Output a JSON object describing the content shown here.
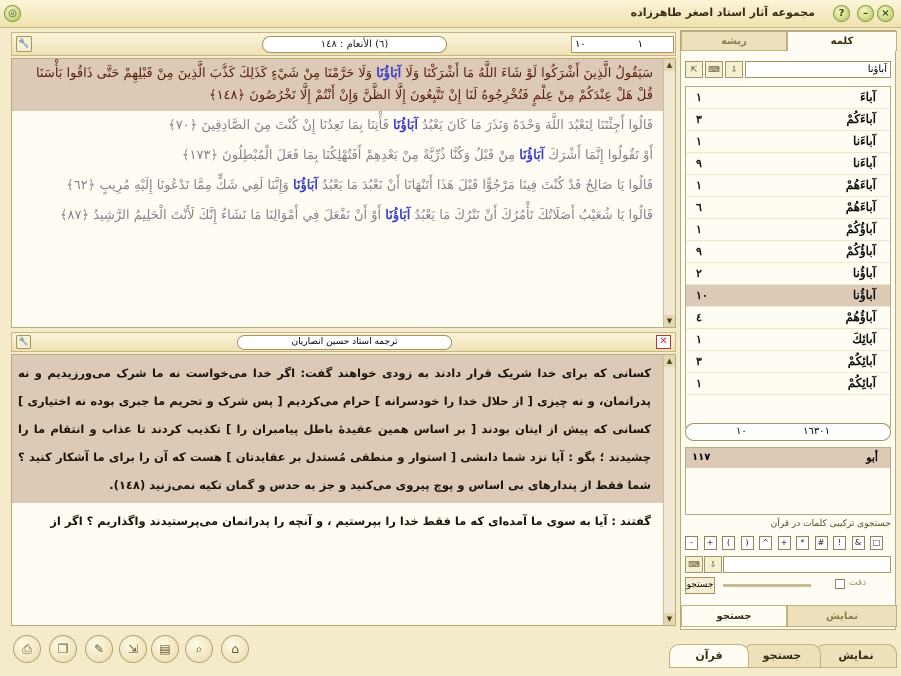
{
  "app": {
    "title": "مجموعه آثار استاد اصغر طاهرزاده"
  },
  "verse_bar": {
    "surah": "(٦) الأنعام : ١٤٨",
    "ayah_left": "١٠",
    "ayah_right": "١"
  },
  "verses": [
    {
      "before": "سَيَقُولُ الَّذِينَ أَشْرَكُوا لَوْ شَاءَ اللَّهُ مَا أَشْرَكْنَا وَلَا ",
      "hl": "آبَاؤُنَا",
      "after": " وَلَا حَرَّمْنَا مِنْ شَيْءٍ كَذَلِكَ كَذَّبَ الَّذِينَ مِنْ قَبْلِهِمْ حَتَّى ذَاقُوا بَأْسَنَا قُلْ هَلْ عِنْدَكُمْ مِنْ عِلْمٍ فَتُخْرِجُوهُ لَنَا إِنْ تَتَّبِعُونَ إِلَّا الظَّنَّ وَإِنْ أَنْتُمْ إِلَّا تَخْرُصُونَ ﴿١٤٨﴾"
    },
    {
      "before": "قَالُوا أَجِئْتَنَا لِنَعْبُدَ اللَّهَ وَحْدَهُ وَنَذَرَ مَا كَانَ يَعْبُدُ ",
      "hl": "آبَاؤُنَا",
      "after": " فَأْتِنَا بِمَا تَعِدُنَا إِنْ كُنْتَ مِنَ الصَّادِقِينَ ﴿٧٠﴾"
    },
    {
      "before": "أَوْ تَقُولُوا إِنَّمَا أَشْرَكَ ",
      "hl": "آبَاؤُنَا",
      "after": " مِنْ قَبْلُ وَكُنَّا ذُرِّيَّةً مِنْ بَعْدِهِمْ أَفَتُهْلِكُنَا بِمَا فَعَلَ الْمُبْطِلُونَ ﴿١٧٣﴾"
    },
    {
      "before": "قَالُوا يَا صَالِحُ قَدْ كُنْتَ فِينَا مَرْجُوًّا قَبْلَ هَذَا أَتَنْهَانَا أَنْ نَعْبُدَ مَا يَعْبُدُ ",
      "hl": "آبَاؤُنَا",
      "after": " وَإِنَّنَا لَفِي شَكٍّ مِمَّا تَدْعُونَا إِلَيْهِ مُرِيبٍ ﴿٦٢﴾"
    },
    {
      "before": "قَالُوا يَا شُعَيْبُ أَصَلَاتُكَ تَأْمُرُكَ أَنْ نَتْرُكَ مَا يَعْبُدُ ",
      "hl": "آبَاؤُنَا",
      "after": " أَوْ أَنْ نَفْعَلَ فِي أَمْوَالِنَا مَا نَشَاءُ إِنَّكَ لَأَنْتَ الْحَلِيمُ الرَّشِيدُ ﴿٨٧﴾"
    }
  ],
  "translation": {
    "title": "ترجمه استاد حسين انصاريان",
    "paragraphs": [
      "کسانی که برای خدا شریک قرار دادند به زودی خواهند گفت: اگر خدا می‌خواست نه ما شرک می‌ورزیدیم و نه پدرانمان، و نه چیزی [ از حلال خدا را خودسرانه ] حرام می‌کردیم [ پس شرک و تحریم ما جبری بوده نه اختیاری ] کسانی که پیش از اینان بودند [ بر اساس همین عقیدهٔ باطل پیامبران را ] تکذیب کردند تا عذاب و انتقام ما را چشیدند ؛ بگو : آیا نزد شما دانشی [ استوار و منطقی مُستدل بر عقایدتان ] هست که آن را برای ما آشکار کنید ؟ شما فقط از پندارهای بی اساس و پوچ پیروی می‌کنید و جز به حدس و گمان تکیه نمی‌زنید (١٤٨).",
      "گفتند : آیا به سوی ما آمده‌ای که ما فقط خدا را بپرستیم ، و آنچه را پدرانمان می‌پرستیدند واگذاریم ؟ اگر از"
    ]
  },
  "sidebar": {
    "tab_root": "ریشه",
    "tab_word": "کلمه",
    "word_input": "آباؤنا",
    "words": [
      {
        "w": "آباءَ",
        "c": "١"
      },
      {
        "w": "آباءَكُمْ",
        "c": "٣"
      },
      {
        "w": "آباءَنا",
        "c": "١"
      },
      {
        "w": "آباءَنا",
        "c": "٩"
      },
      {
        "w": "آباءَهُمْ",
        "c": "١"
      },
      {
        "w": "آباءَهُمْ",
        "c": "٦"
      },
      {
        "w": "آباؤُكُمْ",
        "c": "١"
      },
      {
        "w": "آباؤُكُمْ",
        "c": "٩"
      },
      {
        "w": "آباؤُنا",
        "c": "٢"
      },
      {
        "w": "آباؤُنا",
        "c": "١٠"
      },
      {
        "w": "آباؤُهُمْ",
        "c": "٤"
      },
      {
        "w": "آبائِكَ",
        "c": "١"
      },
      {
        "w": "آبائِكُمْ",
        "c": "٣"
      },
      {
        "w": "آبائِكُمْ",
        "c": "١"
      }
    ],
    "selected_index": 9,
    "pager_left": "١٠",
    "pager_right": "١٦٣٠١",
    "root_word": "أبو",
    "root_count": "١١٧",
    "combo_title": "جستجوی ترکیبی کلمات در قرآن",
    "symbols": [
      "-",
      "+",
      "(",
      ")",
      "^",
      "+",
      "*",
      "#",
      "!",
      "&",
      "□"
    ],
    "search_button": "جستجو",
    "precise_label": "دقت",
    "tab_search": "جستجو",
    "tab_display": "نمایش"
  },
  "bottom_tabs": {
    "quran": "قرآن",
    "search": "جستجو",
    "display": "نمایش"
  },
  "tools": [
    "print-icon",
    "copy-icon",
    "note-icon",
    "export-icon",
    "page-icon",
    "search-icon",
    "bookmark-icon"
  ]
}
